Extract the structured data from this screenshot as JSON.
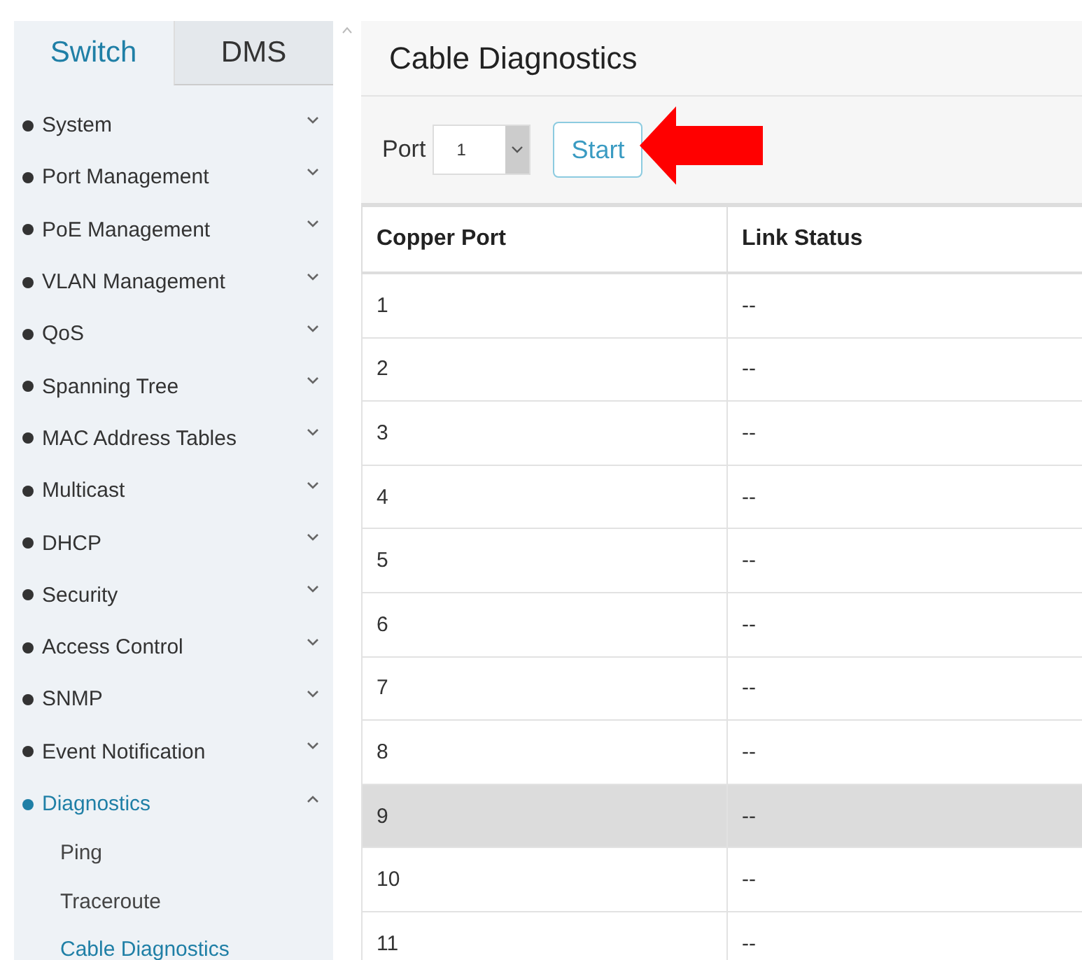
{
  "tabs": [
    {
      "label": "Switch",
      "selected": true
    },
    {
      "label": "DMS",
      "selected": false
    }
  ],
  "menu": [
    {
      "label": "System",
      "expanded": false,
      "selected": false
    },
    {
      "label": "Port Management",
      "expanded": false,
      "selected": false
    },
    {
      "label": "PoE Management",
      "expanded": false,
      "selected": false
    },
    {
      "label": "VLAN Management",
      "expanded": false,
      "selected": false
    },
    {
      "label": "QoS",
      "expanded": false,
      "selected": false
    },
    {
      "label": "Spanning Tree",
      "expanded": false,
      "selected": false
    },
    {
      "label": "MAC Address Tables",
      "expanded": false,
      "selected": false
    },
    {
      "label": "Multicast",
      "expanded": false,
      "selected": false
    },
    {
      "label": "DHCP",
      "expanded": false,
      "selected": false
    },
    {
      "label": "Security",
      "expanded": false,
      "selected": false
    },
    {
      "label": "Access Control",
      "expanded": false,
      "selected": false
    },
    {
      "label": "SNMP",
      "expanded": false,
      "selected": false
    },
    {
      "label": "Event Notification",
      "expanded": false,
      "selected": false
    },
    {
      "label": "Diagnostics",
      "expanded": true,
      "selected": true,
      "children": [
        {
          "label": "Ping",
          "selected": false
        },
        {
          "label": "Traceroute",
          "selected": false
        },
        {
          "label": "Cable Diagnostics",
          "selected": true
        }
      ]
    }
  ],
  "page_title": "Cable Diagnostics",
  "port_field": {
    "label": "Port",
    "value": "1"
  },
  "start_button": "Start",
  "table": {
    "columns": [
      "Copper Port",
      "Link Status"
    ],
    "rows": [
      {
        "cells": [
          "1",
          "--"
        ],
        "selected": false
      },
      {
        "cells": [
          "2",
          "--"
        ],
        "selected": false
      },
      {
        "cells": [
          "3",
          "--"
        ],
        "selected": false
      },
      {
        "cells": [
          "4",
          "--"
        ],
        "selected": false
      },
      {
        "cells": [
          "5",
          "--"
        ],
        "selected": false
      },
      {
        "cells": [
          "6",
          "--"
        ],
        "selected": false
      },
      {
        "cells": [
          "7",
          "--"
        ],
        "selected": false
      },
      {
        "cells": [
          "8",
          "--"
        ],
        "selected": false
      },
      {
        "cells": [
          "9",
          "--"
        ],
        "selected": true
      },
      {
        "cells": [
          "10",
          "--"
        ],
        "selected": false
      },
      {
        "cells": [
          "11",
          "--"
        ],
        "selected": false
      }
    ]
  }
}
